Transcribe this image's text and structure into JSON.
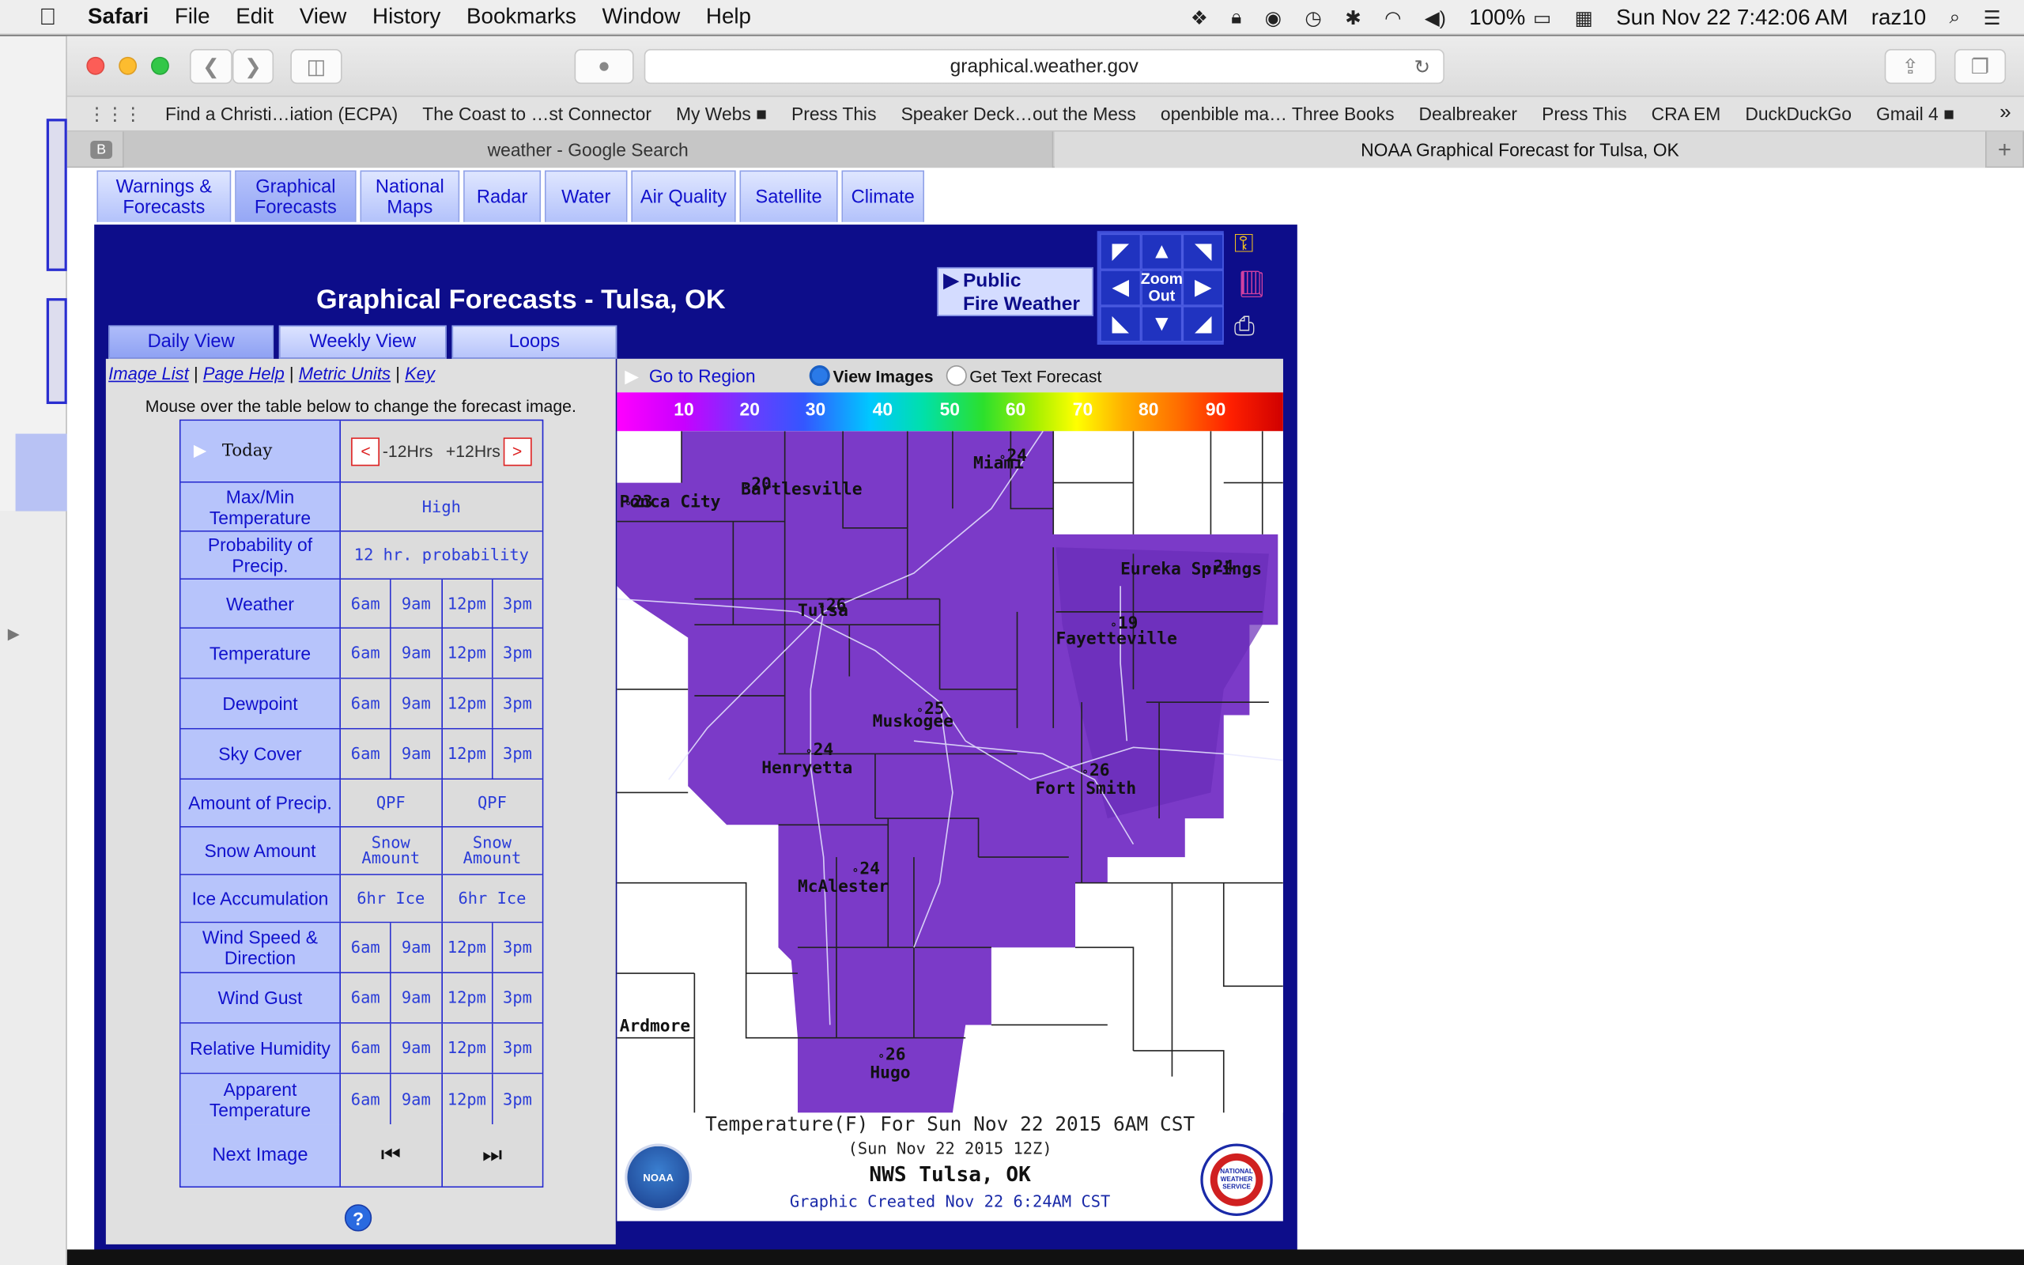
{
  "menubar": {
    "apple": "",
    "app": "Safari",
    "items": [
      "File",
      "Edit",
      "View",
      "History",
      "Bookmarks",
      "Window",
      "Help"
    ],
    "battery": "100%",
    "datetime": "Sun Nov 22  7:42:06 AM",
    "user": "raz10"
  },
  "browser": {
    "url": "graphical.weather.gov",
    "bookmarks": [
      "Find a Christi…iation (ECPA)",
      "The Coast to …st Connector",
      "My Webs ■",
      "Press This",
      "Speaker Deck…out the Mess",
      "openbible ma… Three Books",
      "Dealbreaker",
      "Press This",
      "CRA EM",
      "DuckDuckGo",
      "Gmail 4 ■"
    ],
    "tabs": [
      "weather - Google Search",
      "NOAA Graphical Forecast for Tulsa, OK"
    ],
    "tab_badge": "B"
  },
  "nav_tabs": [
    {
      "l1": "Warnings &",
      "l2": "Forecasts"
    },
    {
      "l1": "Graphical",
      "l2": "Forecasts"
    },
    {
      "l1": "National",
      "l2": "Maps"
    },
    {
      "l1": "Radar",
      "l2": ""
    },
    {
      "l1": "Water",
      "l2": ""
    },
    {
      "l1": "Air Quality",
      "l2": ""
    },
    {
      "l1": "Satellite",
      "l2": ""
    },
    {
      "l1": "Climate",
      "l2": ""
    }
  ],
  "page": {
    "title": "Graphical Forecasts - Tulsa, OK",
    "public": "Public",
    "fire": "Fire Weather",
    "zoom": "Zoom Out",
    "view_tabs": [
      "Daily View",
      "Weekly View",
      "Loops"
    ],
    "links": [
      "Image List",
      "Page Help",
      "Metric Units",
      "Key"
    ],
    "mouseover": "Mouse over the table below to change the forecast image.",
    "today": "Today",
    "minus12": "-12Hrs",
    "plus12": "+12Hrs",
    "rows": [
      {
        "label": "Max/Min Temperature",
        "cells": [
          "High"
        ]
      },
      {
        "label": "Probability of Precip.",
        "cells": [
          "12 hr. probability"
        ]
      },
      {
        "label": "Weather",
        "cells": [
          "6am",
          "9am",
          "12pm",
          "3pm"
        ]
      },
      {
        "label": "Temperature",
        "cells": [
          "6am",
          "9am",
          "12pm",
          "3pm"
        ]
      },
      {
        "label": "Dewpoint",
        "cells": [
          "6am",
          "9am",
          "12pm",
          "3pm"
        ]
      },
      {
        "label": "Sky Cover",
        "cells": [
          "6am",
          "9am",
          "12pm",
          "3pm"
        ]
      },
      {
        "label": "Amount of Precip.",
        "cells": [
          "QPF",
          "QPF"
        ]
      },
      {
        "label": "Snow Amount",
        "cells": [
          "Snow Amount",
          "Snow Amount"
        ]
      },
      {
        "label": "Ice Accumulation",
        "cells": [
          "6hr Ice",
          "6hr Ice"
        ]
      },
      {
        "label": "Wind Speed & Direction",
        "cells": [
          "6am",
          "9am",
          "12pm",
          "3pm"
        ]
      },
      {
        "label": "Wind Gust",
        "cells": [
          "6am",
          "9am",
          "12pm",
          "3pm"
        ]
      },
      {
        "label": "Relative Humidity",
        "cells": [
          "6am",
          "9am",
          "12pm",
          "3pm"
        ]
      },
      {
        "label": "Apparent Temperature",
        "cells": [
          "6am",
          "9am",
          "12pm",
          "3pm"
        ]
      }
    ],
    "next_image": "Next Image",
    "go_region": "Go to Region",
    "view_images": "View Images",
    "get_text": "Get Text Forecast",
    "scale": [
      "10",
      "20",
      "30",
      "40",
      "50",
      "60",
      "70",
      "80",
      "90"
    ]
  },
  "map": {
    "cities": [
      {
        "name": "Ponca City",
        "temp": "23"
      },
      {
        "name": "Bartlesville",
        "temp": "20"
      },
      {
        "name": "Miami",
        "temp": "24"
      },
      {
        "name": "Eureka Springs",
        "temp": "24"
      },
      {
        "name": "Tulsa",
        "temp": "26"
      },
      {
        "name": "Fayetteville",
        "temp": "19"
      },
      {
        "name": "Muskogee",
        "temp": "25"
      },
      {
        "name": "Henryetta",
        "temp": "24"
      },
      {
        "name": "Fort Smith",
        "temp": "26"
      },
      {
        "name": "McAlester",
        "temp": "24"
      },
      {
        "name": "Ardmore",
        "temp": ""
      },
      {
        "name": "Hugo",
        "temp": "26"
      }
    ],
    "caption1": "Temperature(F) For Sun Nov 22 2015   6AM CST",
    "caption2": "(Sun Nov 22 2015 12Z)",
    "caption3": "NWS Tulsa, OK",
    "caption4": "Graphic Created Nov 22  6:24AM CST",
    "noaa_logo": "NOAA",
    "nws_logo": "NATIONAL WEATHER SERVICE"
  }
}
